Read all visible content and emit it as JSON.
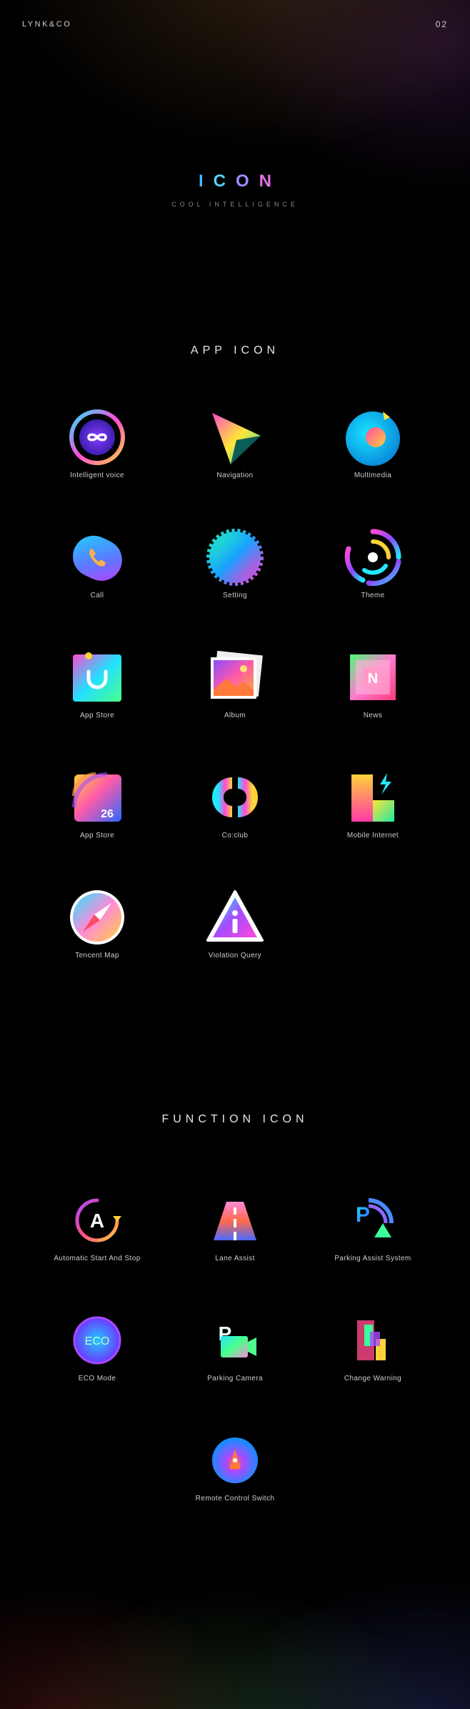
{
  "header": {
    "brand": "LYNK&CO",
    "page_number": "02"
  },
  "hero": {
    "letters": [
      "I",
      "C",
      "O",
      "N"
    ],
    "subtitle": "COOL INTELLIGENCE"
  },
  "app_section": {
    "title": "APP ICON",
    "items": [
      {
        "label": "Intelligent voice",
        "icon": "infinity-ring-icon"
      },
      {
        "label": "Navigation",
        "icon": "navigation-arrow-icon"
      },
      {
        "label": "Multimedia",
        "icon": "music-disc-icon"
      },
      {
        "label": "Call",
        "icon": "phone-icon"
      },
      {
        "label": "Setting",
        "icon": "gear-icon"
      },
      {
        "label": "Theme",
        "icon": "spiral-icon"
      },
      {
        "label": "App Store",
        "icon": "shopping-bag-icon"
      },
      {
        "label": "Album",
        "icon": "photo-album-icon"
      },
      {
        "label": "News",
        "icon": "news-icon"
      },
      {
        "label": "App Store",
        "icon": "calendar-icon",
        "badge": "26"
      },
      {
        "label": "Co:club",
        "icon": "coclub-icon"
      },
      {
        "label": "Mobile Internet",
        "icon": "lightning-chart-icon"
      },
      {
        "label": "Tencent Map",
        "icon": "compass-icon"
      },
      {
        "label": "Violation Query",
        "icon": "warning-info-icon"
      }
    ]
  },
  "function_section": {
    "title": "FUNCTION ICON",
    "items": [
      {
        "label": "Automatic Start And Stop",
        "icon": "auto-start-stop-icon",
        "glyph": "A"
      },
      {
        "label": "Lane Assist",
        "icon": "lane-road-icon"
      },
      {
        "label": "Parking Assist System",
        "icon": "parking-assist-icon",
        "glyph": "P"
      },
      {
        "label": "ECO Mode",
        "icon": "eco-mode-icon",
        "glyph": "ECO"
      },
      {
        "label": "Parking Camera",
        "icon": "parking-camera-icon",
        "glyph": "P"
      },
      {
        "label": "Change Warning",
        "icon": "change-warning-icon"
      },
      {
        "label": "Remote Control Switch",
        "icon": "remote-control-icon"
      }
    ]
  }
}
